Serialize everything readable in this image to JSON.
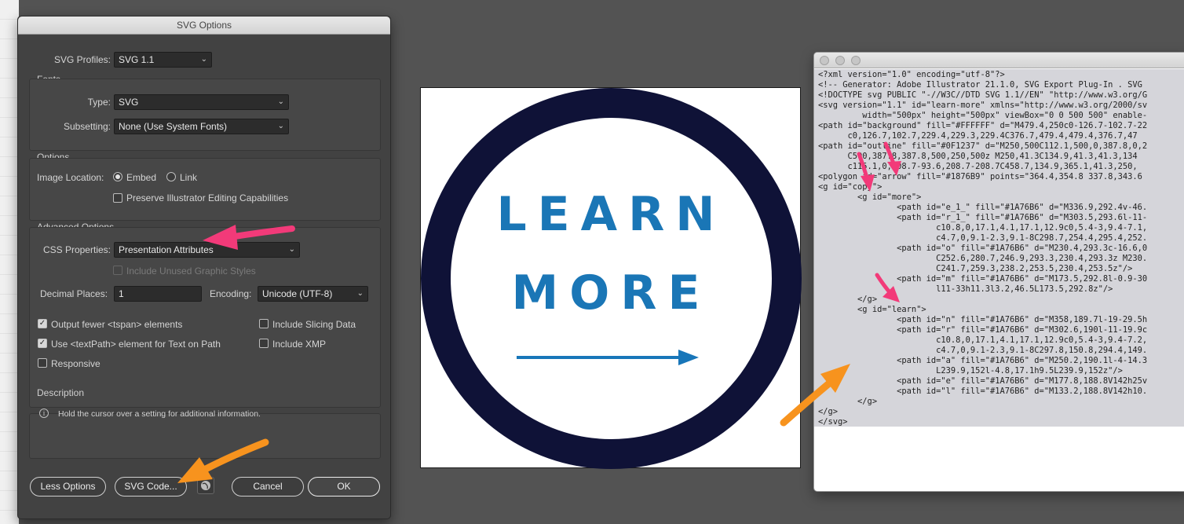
{
  "dialog": {
    "title": "SVG Options",
    "svg_profiles": {
      "label": "SVG Profiles:",
      "value": "SVG 1.1"
    },
    "fonts": {
      "heading": "Fonts",
      "type": {
        "label": "Type:",
        "value": "SVG"
      },
      "subsetting": {
        "label": "Subsetting:",
        "value": "None (Use System Fonts)"
      }
    },
    "options": {
      "heading": "Options",
      "image_location_label": "Image Location:",
      "embed_label": "Embed",
      "link_label": "Link",
      "preserve_label": "Preserve Illustrator Editing Capabilities"
    },
    "advanced": {
      "heading": "Advanced Options",
      "css_label": "CSS Properties:",
      "css_value": "Presentation Attributes",
      "unused_styles_label": "Include Unused Graphic Styles",
      "decimal_label": "Decimal Places:",
      "decimal_value": "1",
      "encoding_label": "Encoding:",
      "encoding_value": "Unicode (UTF-8)",
      "tspan_label": "Output fewer <tspan> elements",
      "textpath_label": "Use <textPath> element for Text on Path",
      "responsive_label": "Responsive",
      "slicing_label": "Include Slicing Data",
      "xmp_label": "Include XMP"
    },
    "description": {
      "heading": "Description",
      "text": "Hold the cursor over a setting for additional information."
    },
    "buttons": {
      "less_options": "Less Options",
      "svg_code": "SVG Code...",
      "cancel": "Cancel",
      "ok": "OK"
    }
  },
  "artboard": {
    "line1": "LEARN",
    "line2": "MORE",
    "colors": {
      "ring": "#0F1237",
      "text": "#1A76B6",
      "arrow": "#1876B9"
    }
  },
  "code_window": {
    "lines": [
      "<?xml version=\"1.0\" encoding=\"utf-8\"?>",
      "<!-- Generator: Adobe Illustrator 21.1.0, SVG Export Plug-In . SVG",
      "<!DOCTYPE svg PUBLIC \"-//W3C//DTD SVG 1.1//EN\" \"http://www.w3.org/G",
      "<svg version=\"1.1\" id=\"learn-more\" xmlns=\"http://www.w3.org/2000/sv",
      "         width=\"500px\" height=\"500px\" viewBox=\"0 0 500 500\" enable-",
      "<path id=\"background\" fill=\"#FFFFFF\" d=\"M479.4,250c0-126.7-102.7-22",
      "      c0,126.7,102.7,229.4,229.3,229.4C376.7,479.4,479.4,376.7,47",
      "<path id=\"outline\" fill=\"#0F1237\" d=\"M250,500C112.1,500,0,387.8,0,2",
      "      C500,387.8,387.8,500,250,500z M250,41.3C134.9,41.3,41.3,134",
      "      c115.1,0,208.7-93.6,208.7-208.7C458.7,134.9,365.1,41.3,250,",
      "<polygon id=\"arrow\" fill=\"#1876B9\" points=\"364.4,354.8 337.8,343.6 ",
      "<g id=\"copy\">",
      "        <g id=\"more\">",
      "                <path id=\"e_1_\" fill=\"#1A76B6\" d=\"M336.9,292.4v-46.",
      "                <path id=\"r_1_\" fill=\"#1A76B6\" d=\"M303.5,293.6l-11-",
      "                        c10.8,0,17.1,4.1,17.1,12.9c0,5.4-3,9.4-7.1,",
      "                        c4.7,0,9.1-2.3,9.1-8C298.7,254.4,295.4,252.",
      "                <path id=\"o\" fill=\"#1A76B6\" d=\"M230.4,293.3c-16.6,0",
      "                        C252.6,280.7,246.9,293.3,230.4,293.3z M230.",
      "                        C241.7,259.3,238.2,253.5,230.4,253.5z\"/>",
      "                <path id=\"m\" fill=\"#1A76B6\" d=\"M173.5,292.8l-0.9-30",
      "                        l11-33h11.3l3.2,46.5L173.5,292.8z\"/>",
      "        </g>",
      "        <g id=\"learn\">",
      "                <path id=\"n\" fill=\"#1A76B6\" d=\"M358,189.7l-19-29.5h",
      "                <path id=\"r\" fill=\"#1A76B6\" d=\"M302.6,190l-11-19.9c",
      "                        c10.8,0,17.1,4.1,17.1,12.9c0,5.4-3,9.4-7.2,",
      "                        c4.7,0,9.1-2.3,9.1-8C297.8,150.8,294.4,149.",
      "                <path id=\"a\" fill=\"#1A76B6\" d=\"M250.2,190.1l-4-14.3",
      "                        L239.9,152l-4.8,17.1h9.5L239.9,152z\"/>",
      "                <path id=\"e\" fill=\"#1A76B6\" d=\"M177.8,188.8V142h25v",
      "                <path id=\"l\" fill=\"#1A76B6\" d=\"M133.2,188.8V142h10.",
      "        </g>",
      "</g>",
      "</svg>"
    ]
  },
  "annotations": {
    "pink_arrow_color": "#F23A79",
    "orange_arrow_color": "#F7931E"
  }
}
